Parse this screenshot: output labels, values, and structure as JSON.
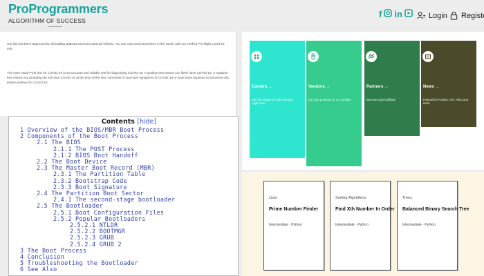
{
  "header": {
    "logo_title": "ProProgrammers",
    "logo_subtitle": "ALGORITHM OF SUCCESS",
    "social_icons": [
      "facebook-icon",
      "instagram-icon",
      "linkedin-icon",
      "youtube-icon"
    ],
    "brand_color": "#1aa39b",
    "login_label": "Login",
    "register_label": "Register"
  },
  "text_panel": {
    "paragraph1": "Our lab has been approved by all leading National and International Airlines. You can now travel anywhere in the world, with our verified Pre-flight Covid-19 test.",
    "paragraph2": "The nose swab PCR test for COVID-19 is an accurate and reliable test for diagnosing COVID-19. A positive test means you likely have COVID-19. A negative test means you probably did not have COVID-19 at the time of the test. Get tested if you have symptoms of COVID-19 or have been exposed to someone who tested positive for COVID-19."
  },
  "toc": {
    "title": "Contents",
    "hide_label": "[hide]",
    "lines": [
      {
        "indent": 0,
        "text": "1 Overview of the BIOS/MBR Boot Process"
      },
      {
        "indent": 0,
        "text": "2 Components of the Boot Process"
      },
      {
        "indent": 1,
        "text": "2.1 The BIOS"
      },
      {
        "indent": 2,
        "text": "2.1.1 The POST Process"
      },
      {
        "indent": 2,
        "text": "2.1.2 BIOS Boot Handoff"
      },
      {
        "indent": 1,
        "text": "2.2 The Boot Device"
      },
      {
        "indent": 1,
        "text": "2.3 The Master Boot Record (MBR)"
      },
      {
        "indent": 2,
        "text": "2.3.1 The Partition Table"
      },
      {
        "indent": 2,
        "text": "2.3.2 Bootstrap Code"
      },
      {
        "indent": 2,
        "text": "2.3.3 Boot Signature"
      },
      {
        "indent": 1,
        "text": "2.4 The Partition Boot Sector"
      },
      {
        "indent": 2,
        "text": "2.4.1 The second-stage bootloader"
      },
      {
        "indent": 1,
        "text": "2.5 The Bootloader"
      },
      {
        "indent": 2,
        "text": "2.5.1 Boot Configuration Files"
      },
      {
        "indent": 2,
        "text": "2.5.2 Popular Bootloaders"
      },
      {
        "indent": 3,
        "text": "2.5.2.1 NTLDR"
      },
      {
        "indent": 3,
        "text": "2.5.2.2 BOOTMGR"
      },
      {
        "indent": 3,
        "text": "2.5.2.3 GRUB"
      },
      {
        "indent": 3,
        "text": "2.5.2.4 GRUB 2"
      },
      {
        "indent": 0,
        "text": "3 The Boot Process"
      },
      {
        "indent": 0,
        "text": "4 Conclusion"
      },
      {
        "indent": 0,
        "text": "5 Troubleshooting the Bootloader"
      },
      {
        "indent": 0,
        "text": "6 See Also"
      }
    ]
  },
  "cards": [
    {
      "title": "Careers →",
      "desc": "Join the league of code wizards. Apply now.",
      "color": "#2ee6cf",
      "icon": "people-icon"
    },
    {
      "title": "Vendors →",
      "desc": "List your products on our website",
      "color": "#35cc8e",
      "icon": "vendor-icon"
    },
    {
      "title": "Partners →",
      "desc": "Become a joint affiliate",
      "color": "#2e7d4a",
      "icon": "partners-icon"
    },
    {
      "title": "News →",
      "desc": "Featured in Forbes, NYT, WSJ and more",
      "color": "#4b4b2b",
      "icon": "news-icon"
    }
  ],
  "problems": [
    {
      "category": "Lists",
      "title": "Prime Number Finder",
      "meta": "Intermediate · Python"
    },
    {
      "category": "Sorting Algorithms",
      "title": "Find Xth Number In Order",
      "meta": "Intermediate · Python"
    },
    {
      "category": "Trees",
      "title": "Balanced Binary Search Tree",
      "meta": "Intermediate · Python"
    }
  ]
}
